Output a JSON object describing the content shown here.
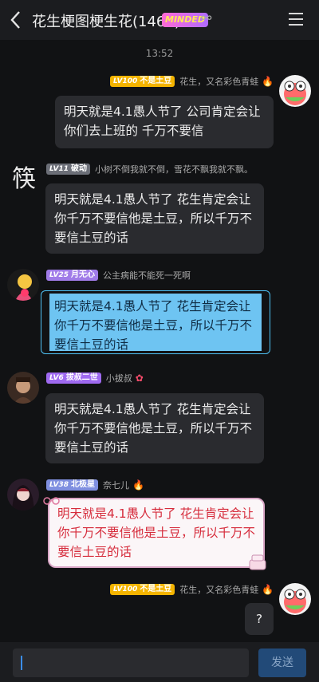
{
  "header": {
    "title": "花生梗图梗生花(1468)",
    "badge": "MINDED",
    "ear_icon": "ear-icon",
    "menu_icon": "menu-icon"
  },
  "time": "13:52",
  "messages": [
    {
      "level": "LV100",
      "title": "不是土豆",
      "name": "花生，又名彩色青蛙",
      "text": "明天就是4.1愚人节了 公司肯定会让你们去上班的 千万不要信"
    },
    {
      "level": "LV11",
      "title": "破动",
      "name": "小树不倒我就不倒，雪花不飘我就不飘。",
      "text": "明天就是4.1愚人节了 花生肯定会让你千万不要信他是土豆，所以千万不要信土豆的话"
    },
    {
      "level": "LV25",
      "title": "月无心",
      "name": "公主病能不能死一死啊",
      "text": "明天就是4.1愚人节了 花生肯定会让你千万不要信他是土豆，所以千万不要信土豆的话"
    },
    {
      "level": "LV6",
      "title": "拔叔二世",
      "name": "小拔叔",
      "text": "明天就是4.1愚人节了 花生肯定会让你千万不要信他是土豆，所以千万不要信土豆的话"
    },
    {
      "level": "LV38",
      "title": "北极星",
      "name": "奈七儿",
      "text": "明天就是4.1愚人节了 花生肯定会让你千万不要信他是土豆，所以千万不要信土豆的话"
    },
    {
      "level": "LV100",
      "title": "不是土豆",
      "name": "花生，又名彩色青蛙",
      "text": "?"
    }
  ],
  "footer": {
    "send_label": "发送"
  }
}
